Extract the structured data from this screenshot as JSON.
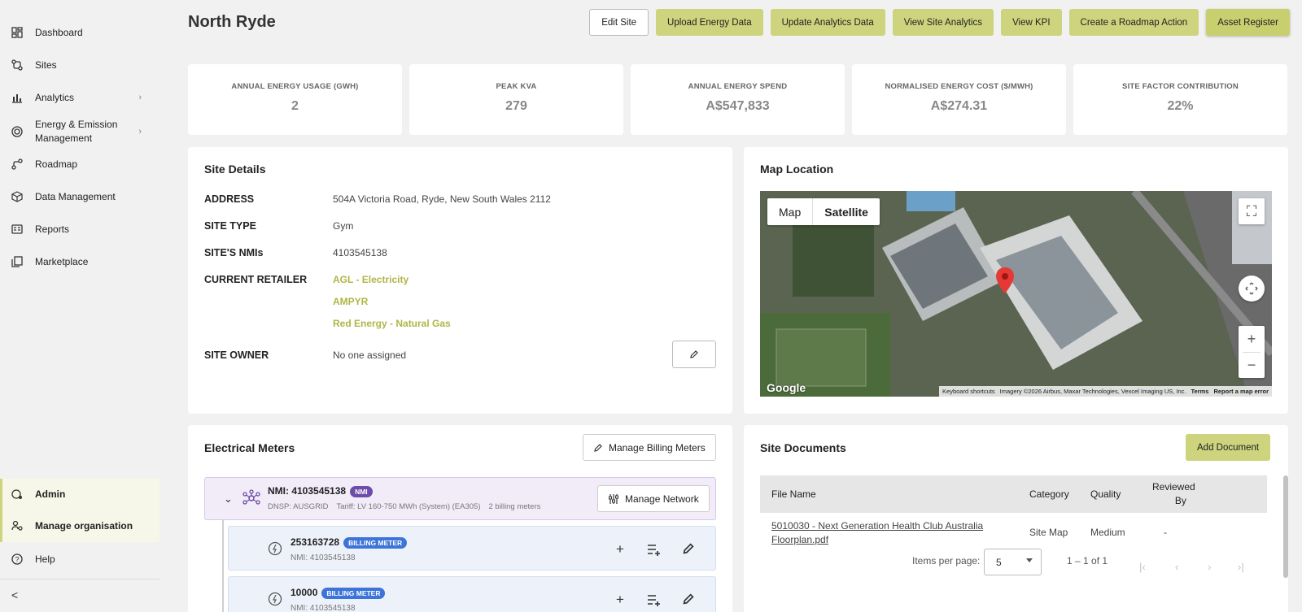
{
  "sidebar": {
    "items": [
      {
        "label": "Dashboard",
        "icon": "dashboard-icon"
      },
      {
        "label": "Sites",
        "icon": "sites-icon"
      },
      {
        "label": "Analytics",
        "icon": "bar-chart-icon"
      },
      {
        "label": "Energy & Emission Management",
        "icon": "target-icon"
      },
      {
        "label": "Roadmap",
        "icon": "roadmap-icon"
      },
      {
        "label": "Data Management",
        "icon": "cube-icon"
      },
      {
        "label": "Reports",
        "icon": "report-icon"
      },
      {
        "label": "Marketplace",
        "icon": "marketplace-icon"
      }
    ],
    "bottom_items": [
      {
        "label": "Admin",
        "icon": "admin-icon"
      },
      {
        "label": "Manage organisation",
        "icon": "manage-org-icon"
      },
      {
        "label": "Help",
        "icon": "help-icon"
      }
    ],
    "collapse_glyph": "<"
  },
  "header": {
    "title": "North Ryde",
    "buttons": [
      "Edit Site",
      "Upload Energy Data",
      "Update Analytics Data",
      "View Site Analytics",
      "View KPI",
      "Create a Roadmap Action",
      "Asset Register"
    ]
  },
  "kpis": [
    {
      "label": "ANNUAL ENERGY USAGE (GWH)",
      "value": "2"
    },
    {
      "label": "PEAK KVA",
      "value": "279"
    },
    {
      "label": "ANNUAL ENERGY SPEND",
      "value": "A$547,833"
    },
    {
      "label": "NORMALISED ENERGY COST ($/MWH)",
      "value": "A$274.31"
    },
    {
      "label": "SITE FACTOR CONTRIBUTION",
      "value": "22%"
    }
  ],
  "site_details": {
    "title": "Site Details",
    "address_label": "ADDRESS",
    "address": "504A Victoria Road, Ryde, New South Wales 2112",
    "site_type_label": "SITE TYPE",
    "site_type": "Gym",
    "nmis_label": "SITE'S NMIs",
    "nmis": "4103545138",
    "retailer_label": "CURRENT RETAILER",
    "retailers": [
      "AGL - Electricity",
      "AMPYR",
      "Red Energy - Natural Gas"
    ],
    "owner_label": "SITE OWNER",
    "owner": "No one assigned"
  },
  "map": {
    "title": "Map Location",
    "tab_map": "Map",
    "tab_satellite": "Satellite",
    "google": "Google",
    "attribution": [
      "Keyboard shortcuts",
      "Imagery ©2026 Airbus, Maxar Technologies, Vexcel Imaging US, Inc.",
      "Terms",
      "Report a map error"
    ]
  },
  "meters": {
    "title": "Electrical Meters",
    "manage_billing": "Manage Billing Meters",
    "nmi_title": "NMI: 4103545138",
    "nmi_badge": "NMI",
    "nmi_dnsp": "DNSP: AUSGRID",
    "nmi_tariff": "Tariff: LV 160-750 MWh (System) (EA305)",
    "nmi_count": "2 billing meters",
    "manage_network": "Manage Network",
    "rows": [
      {
        "number": "253163728",
        "badge": "BILLING METER",
        "nmi": "NMI: 4103545138"
      },
      {
        "number": "10000",
        "badge": "BILLING METER",
        "nmi": "NMI: 4103545138"
      }
    ]
  },
  "documents": {
    "title": "Site Documents",
    "add_button": "Add Document",
    "columns": {
      "file": "File Name",
      "category": "Category",
      "quality": "Quality",
      "reviewed_1": "Reviewed",
      "reviewed_2": "By"
    },
    "row": {
      "file_1": "5010030 - Next Generation Health Club Australia",
      "file_2": "Floorplan.pdf",
      "category": "Site Map",
      "quality": "Medium",
      "reviewed": "-"
    },
    "items_per_page_label": "Items per page:",
    "items_per_page": "5",
    "range": "1 – 1 of 1"
  },
  "colors": {
    "accent": "#cdd47d",
    "retailer": "#b0b547",
    "nmi_badge": "#6d4ba8",
    "billing_badge": "#3c74d9"
  }
}
